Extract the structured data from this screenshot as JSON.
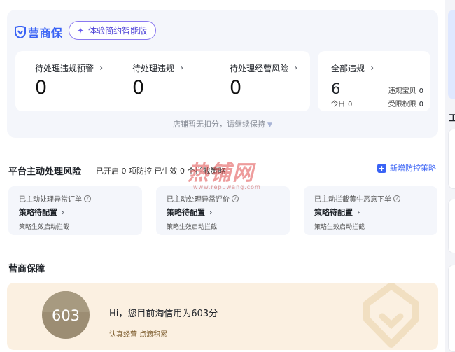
{
  "brand": {
    "logo_text": "营商保",
    "try_button": "体验简约智能版"
  },
  "warnings": [
    {
      "label": "待处理违规预警",
      "value": "0"
    },
    {
      "label": "待处理违规",
      "value": "0"
    },
    {
      "label": "待处理经营风险",
      "value": "0"
    }
  ],
  "all_violations": {
    "label": "全部违规",
    "value": "6",
    "today_label": "今日",
    "today_value": "0",
    "stats": [
      {
        "label": "违规宝贝",
        "value": "0"
      },
      {
        "label": "受限权限",
        "value": "0"
      }
    ]
  },
  "tip": "店铺暂无扣分，请继续保持",
  "risk": {
    "title": "平台主动处理风险",
    "subtitle": "已开启 0 项防控 已生效 0 个拦截策略",
    "add_label": "新增防控策略",
    "cards": [
      {
        "label": "已主动处理异常订单",
        "status": "策略待配置",
        "desc": "策略生效启动拦截"
      },
      {
        "label": "已主动处理异常评价",
        "status": "策略待配置",
        "desc": "策略生效启动拦截"
      },
      {
        "label": "已主动拦截黄牛恶意下单",
        "status": "策略待配置",
        "desc": "策略生效启动拦截"
      }
    ]
  },
  "watermark": {
    "text": "热铺网",
    "url": "www.repuwang.com"
  },
  "guarantee": {
    "title": "营商保障",
    "score": "603",
    "greeting": "Hi，您目前淘信用为603分",
    "sub": "认真经营 点滴积累"
  },
  "right_panel": {
    "char": "工"
  },
  "colors": {
    "accent": "#3a63f5",
    "card_bg": "#f4f6fb",
    "guarantee_bg": "#fbf0e1"
  }
}
